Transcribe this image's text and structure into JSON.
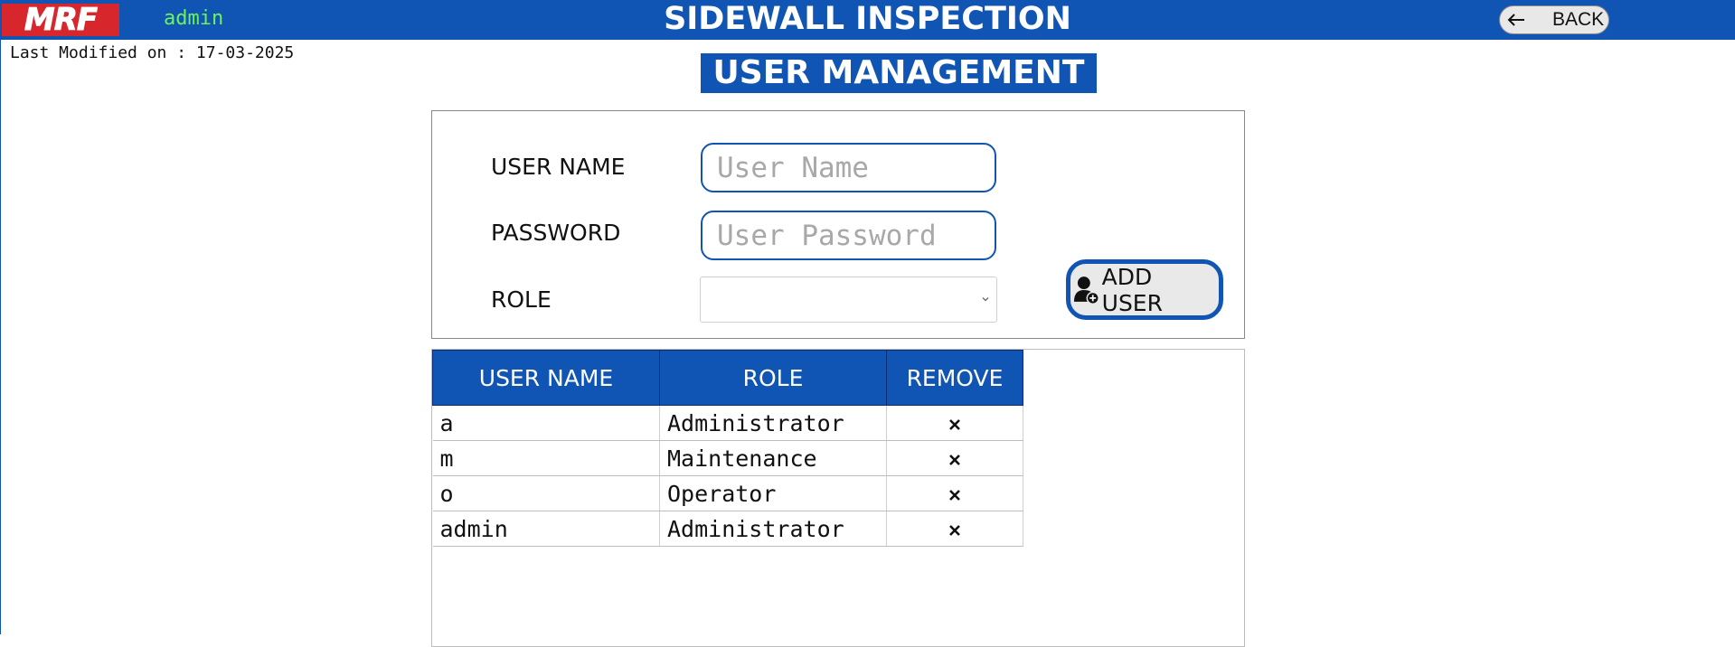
{
  "header": {
    "logo_text": "MRF",
    "current_user": "admin",
    "app_title": "SIDEWALL INSPECTION",
    "back_label": "BACK",
    "last_modified": "Last Modified on : 17-03-2025",
    "colors": {
      "bar": "#1155b4",
      "logo": "#d7262c",
      "user": "#6df25a"
    }
  },
  "page": {
    "title": "USER MANAGEMENT"
  },
  "form": {
    "username_label": "USER NAME",
    "username_placeholder": "User Name",
    "password_label": "PASSWORD",
    "password_placeholder": "User Password",
    "role_label": "ROLE",
    "role_selected": "",
    "add_user_label": "ADD USER",
    "add_user_icon": "add-user-icon"
  },
  "table": {
    "headers": [
      "USER NAME",
      "ROLE",
      "REMOVE"
    ],
    "remove_icon": "close-icon",
    "rows": [
      {
        "user": "a",
        "role": "Administrator"
      },
      {
        "user": "m",
        "role": "Maintenance"
      },
      {
        "user": "o",
        "role": "Operator"
      },
      {
        "user": "admin",
        "role": "Administrator"
      }
    ]
  }
}
